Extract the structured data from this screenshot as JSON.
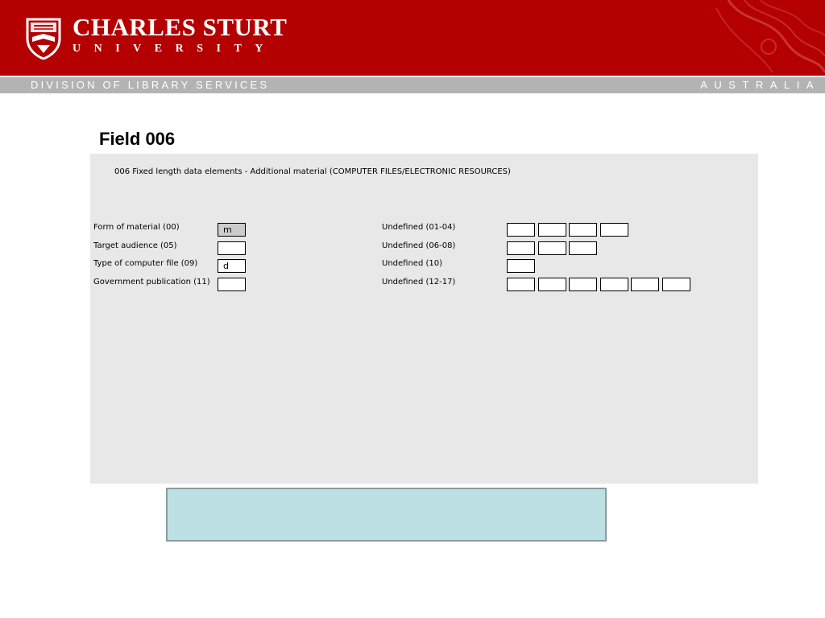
{
  "header": {
    "brand_title": "CHARLES STURT",
    "brand_sub": "UNIVERSITY",
    "division": "DIVISION OF LIBRARY SERVICES",
    "country": "AUSTRALIA",
    "colors": {
      "red": "#b40000",
      "grey_bar": "#b3b3b3"
    }
  },
  "page_title": "Field 006",
  "form": {
    "heading": "006 Fixed length data elements - Additional material (COMPUTER FILES/ELECTRONIC RESOURCES)",
    "left_fields": [
      {
        "label": "Form of material (00)",
        "value": "m"
      },
      {
        "label": "Target audience (05)",
        "value": ""
      },
      {
        "label": "Type of computer file (09)",
        "value": "d"
      },
      {
        "label": "Government publication (11)",
        "value": ""
      }
    ],
    "right_fields": [
      {
        "label": "Undefined (01-04)",
        "values": [
          "",
          "",
          "",
          ""
        ]
      },
      {
        "label": "Undefined (06-08)",
        "values": [
          "",
          "",
          ""
        ]
      },
      {
        "label": "Undefined (10)",
        "values": [
          ""
        ]
      },
      {
        "label": "Undefined (12-17)",
        "values": [
          "",
          "",
          "",
          "",
          "",
          ""
        ]
      }
    ]
  }
}
